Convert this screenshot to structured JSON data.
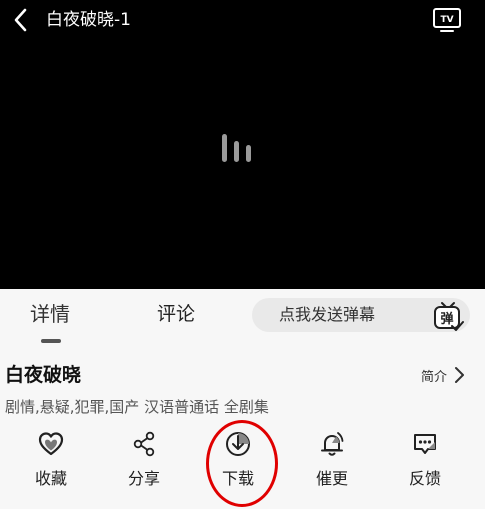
{
  "player": {
    "title": "白夜破晓-1",
    "back_icon": "chevron-left-icon",
    "cast_icon": "tv-icon",
    "loading_icon": "loading-bars-icon"
  },
  "tabs": [
    {
      "label": "详情",
      "active": true
    },
    {
      "label": "评论",
      "active": false
    }
  ],
  "danmaku": {
    "placeholder": "点我发送弹幕",
    "icon_text": "弹"
  },
  "show": {
    "title": "白夜破晓",
    "intro_label": "简介",
    "tags": "剧情,悬疑,犯罪,国产 汉语普通话 全剧集"
  },
  "actions": [
    {
      "label": "收藏",
      "icon": "heart-icon"
    },
    {
      "label": "分享",
      "icon": "share-icon"
    },
    {
      "label": "下载",
      "icon": "download-icon"
    },
    {
      "label": "催更",
      "icon": "bell-icon"
    },
    {
      "label": "反馈",
      "icon": "feedback-icon"
    }
  ],
  "colors": {
    "player_bg": "#000000",
    "page_bg": "#f7f7f7",
    "highlight": "#e00000"
  }
}
